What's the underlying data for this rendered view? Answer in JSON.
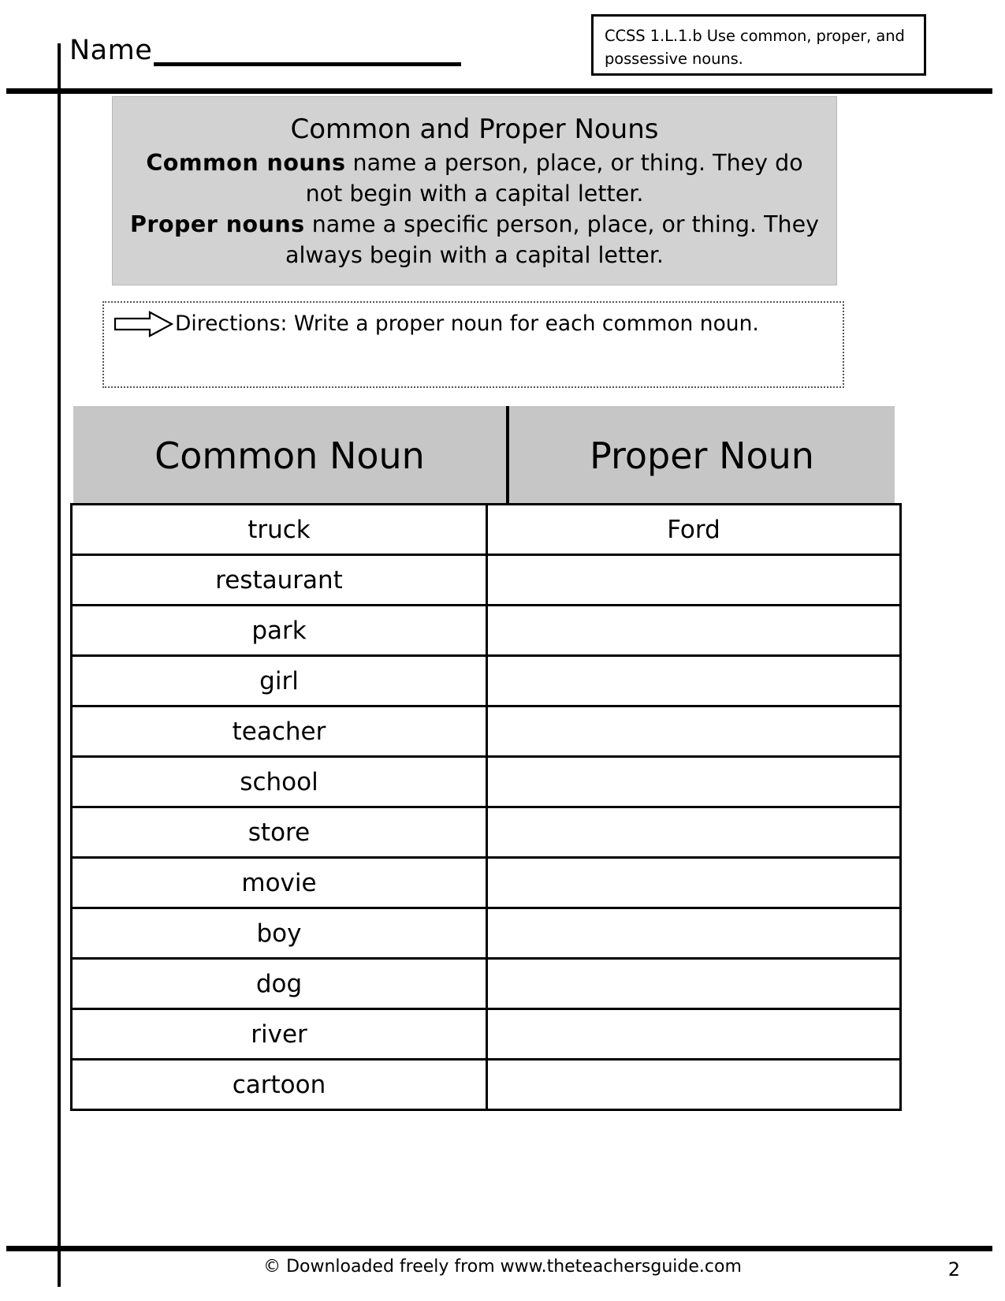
{
  "header": {
    "name_label": "Name",
    "ccss_text": "CCSS 1.L.1.b Use common, proper, and possessive nouns."
  },
  "info_box": {
    "title": "Common and Proper Nouns",
    "line1_bold": "Common nouns",
    "line1_rest": " name a person, place, or thing.  They do not begin with a capital letter.",
    "line2_bold": "Proper nouns",
    "line2_rest": " name a specific person, place, or thing.  They always begin with a capital letter."
  },
  "directions": {
    "icon": "right-arrow-icon",
    "text": "Directions: Write a proper noun for each common noun."
  },
  "table": {
    "columns": [
      "Common Noun",
      "Proper Noun"
    ],
    "rows": [
      {
        "common": "truck",
        "proper": "Ford"
      },
      {
        "common": "restaurant",
        "proper": ""
      },
      {
        "common": "park",
        "proper": ""
      },
      {
        "common": "girl",
        "proper": ""
      },
      {
        "common": "teacher",
        "proper": ""
      },
      {
        "common": "school",
        "proper": ""
      },
      {
        "common": "store",
        "proper": ""
      },
      {
        "common": "movie",
        "proper": ""
      },
      {
        "common": "boy",
        "proper": ""
      },
      {
        "common": "dog",
        "proper": ""
      },
      {
        "common": "river",
        "proper": ""
      },
      {
        "common": "cartoon",
        "proper": ""
      }
    ]
  },
  "footer": {
    "credit": "© Downloaded freely from www.theteachersguide.com",
    "page_number": "2"
  },
  "colors": {
    "info_box_bg": "#d2d2d2",
    "table_header_bg": "#c6c6c6",
    "rule": "#000000",
    "page_bg": "#ffffff"
  }
}
